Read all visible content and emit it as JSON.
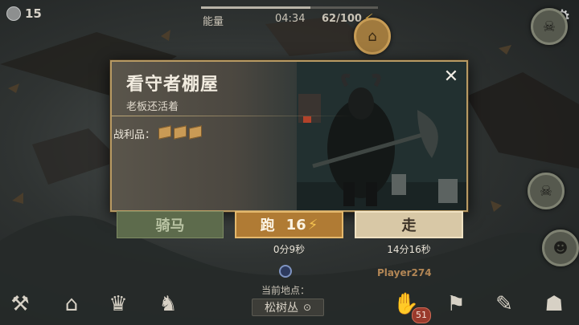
{
  "top_bar": {
    "coins": "15",
    "energy_label": "能量",
    "timer": "04:34",
    "energy": "62/100",
    "energy_fraction": 0.62
  },
  "dialog": {
    "title": "看守者棚屋",
    "subtitle": "老板还活着",
    "loot_label": "战利品：",
    "loot_count": 3
  },
  "actions": {
    "ride_label": "骑马",
    "run_label": "跑",
    "run_cost": "16",
    "run_time": "0分9秒",
    "walk_label": "走",
    "walk_time": "14分16秒"
  },
  "player": {
    "name": "Player274"
  },
  "location": {
    "label": "当前地点：",
    "value": "松树丛"
  },
  "toolbar": {
    "backpack_badge": "51"
  },
  "colors": {
    "accent_gold": "#b07b34",
    "dialog_border": "#b89a63",
    "energy_bolt": "#f3c14f"
  }
}
